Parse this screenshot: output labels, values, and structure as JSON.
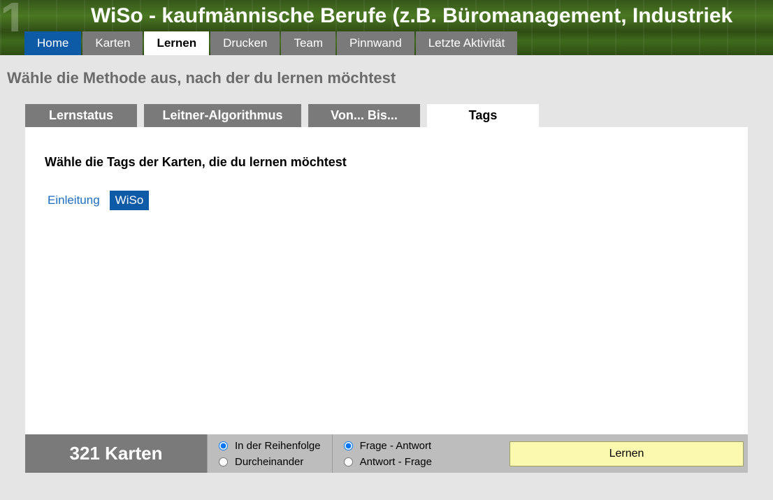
{
  "header": {
    "title": "WiSo - kaufmännische Berufe (z.B. Büromanagement, Industriek",
    "pageNumber": "1"
  },
  "nav": {
    "tabs": [
      {
        "label": "Home"
      },
      {
        "label": "Karten"
      },
      {
        "label": "Lernen"
      },
      {
        "label": "Drucken"
      },
      {
        "label": "Team"
      },
      {
        "label": "Pinnwand"
      },
      {
        "label": "Letzte Aktivität"
      }
    ]
  },
  "subheading": "Wähle die Methode aus, nach der du lernen möchtest",
  "subtabs": [
    {
      "label": "Lernstatus"
    },
    {
      "label": "Leitner-Algorithmus"
    },
    {
      "label": "Von... Bis..."
    },
    {
      "label": "Tags"
    }
  ],
  "panel": {
    "heading": "Wähle die Tags der Karten, die du lernen möchtest",
    "tags": [
      {
        "label": "Einleitung",
        "active": false
      },
      {
        "label": "WiSo",
        "active": true
      }
    ]
  },
  "footer": {
    "count": "321 Karten",
    "orderOptions": {
      "opt1": "In der Reihenfolge",
      "opt2": "Durcheinander"
    },
    "directionOptions": {
      "opt1": "Frage - Antwort",
      "opt2": "Antwort - Frage"
    },
    "learnButton": "Lernen"
  }
}
